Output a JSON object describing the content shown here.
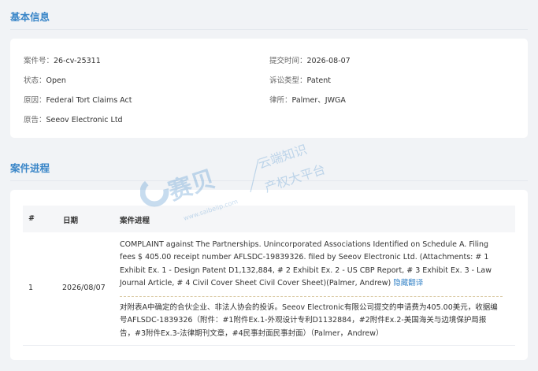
{
  "basic": {
    "title": "基本信息",
    "case_no_label": "案件号：",
    "case_no": "26-cv-25311",
    "submit_label": "提交时间：",
    "submit_date": "2026-08-07",
    "status_label": "状态：",
    "status": "Open",
    "type_label": "诉讼类型：",
    "type": "Patent",
    "cause_label": "原因：",
    "cause": "Federal Tort Claims Act",
    "firm_label": "律所：",
    "firm": "Palmer、JWGA",
    "plaintiff_label": "原告：",
    "plaintiff": "Seeov Electronic Ltd"
  },
  "progress": {
    "title": "案件进程",
    "headers": {
      "num": "#",
      "date": "日期",
      "progress": "案件进程"
    },
    "rows": [
      {
        "num": "1",
        "date": "2026/08/07",
        "text_en": "COMPLAINT against The Partnerships. Unincorporated Associations Identified on Schedule A. Filing fees $ 405.00 receipt number AFLSDC-19839326. filed by Seeov Electronic Ltd. (Attachments: # 1 Exhibit Ex. 1 - Design Patent D1,132,884, # 2 Exhibit Ex. 2 - US CBP Report, # 3 Exhibit Ex. 3 - Law Journal Article, # 4 Civil Cover Sheet Civil Cover Sheet)(Palmer, Andrew)",
        "toggle": "隐藏翻译",
        "text_zh": "对附表A中确定的合伙企业、非法人协会的投诉。Seeov Electronic有限公司提交的申请费为405.00美元，收据编号AFLSDC-1839326（附件：#1附件Ex.1-外观设计专利D1132884，#2附件Ex.2-美国海关与边境保护局报告，#3附件Ex.3-法律期刊文章，#4民事封面民事封面）（Palmer，Andrew）"
      }
    ]
  },
  "watermark": {
    "brand": "赛贝",
    "slogan_1": "云端知识",
    "slogan_2": "产权大平台",
    "url": "www.saibeiip.com"
  },
  "colors": {
    "accent": "#3a86c8",
    "background": "#f1f3f6",
    "card": "#ffffff"
  }
}
